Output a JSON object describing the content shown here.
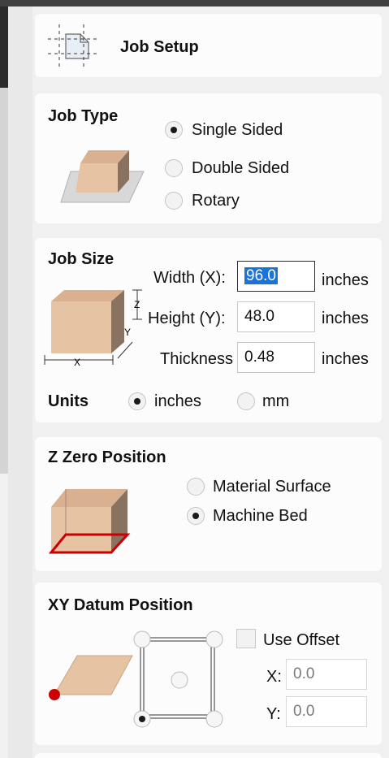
{
  "header": {
    "title": "Job Setup",
    "icon": "job-setup-icon"
  },
  "job_type": {
    "heading": "Job Type",
    "options": [
      {
        "label": "Single Sided",
        "checked": true
      },
      {
        "label": "Double Sided",
        "checked": false
      },
      {
        "label": "Rotary",
        "checked": false
      }
    ]
  },
  "job_size": {
    "heading": "Job Size",
    "width_label": "Width (X):",
    "width_value": "96.0",
    "height_label": "Height (Y):",
    "height_value": "48.0",
    "thickness_label": "Thickness",
    "thickness_value": "0.48",
    "unit": "inches",
    "diagram_x": "X",
    "diagram_y": "Y",
    "diagram_z": "Z",
    "units_label": "Units",
    "units_options": [
      {
        "label": "inches",
        "checked": true
      },
      {
        "label": "mm",
        "checked": false
      }
    ]
  },
  "z_zero": {
    "heading": "Z Zero Position",
    "options": [
      {
        "label": "Material Surface",
        "checked": false
      },
      {
        "label": "Machine Bed",
        "checked": true
      }
    ]
  },
  "xy_datum": {
    "heading": "XY Datum Position",
    "use_offset_label": "Use Offset",
    "use_offset_checked": false,
    "x_label": "X:",
    "x_value": "0.0",
    "y_label": "Y:",
    "y_value": "0.0",
    "selected_point": "bottom-left"
  },
  "colors": {
    "material": "#e6c3a3",
    "accent_red": "#cc0000",
    "selection": "#1a73d8"
  }
}
